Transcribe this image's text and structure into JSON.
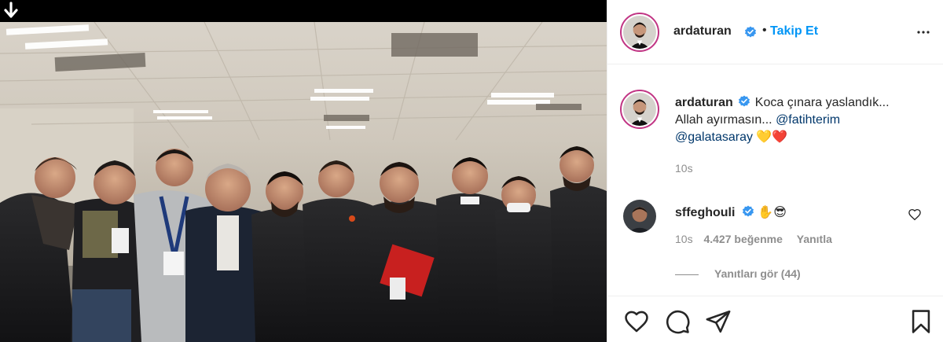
{
  "post": {
    "author": "ardaturan",
    "follow_label": "Takip Et",
    "separator": "•",
    "icons": {
      "download": "arrow-down-icon",
      "verified": "verified-badge-icon",
      "more": "more-options-icon",
      "like": "heart-icon",
      "comment": "comment-icon",
      "share": "paper-plane-icon",
      "save": "bookmark-icon"
    },
    "accent_color": "#0095f6",
    "verified_color": "#3897f0"
  },
  "caption": {
    "username": "ardaturan",
    "text_before": "Koca çınara yaslandık... Allah ayırmasın...",
    "mention1": "@fatihterim",
    "mention2": "@galatasaray",
    "emojis": "💛❤️",
    "time": "10s"
  },
  "comment": {
    "username": "sffeghouli",
    "emojis": "✋😎",
    "time": "10s",
    "likes": "4.427 beğenme",
    "reply_label": "Yanıtla",
    "view_replies": "Yanıtları gör (44)"
  }
}
